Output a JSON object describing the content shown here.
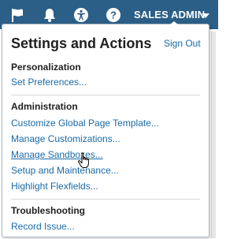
{
  "topbar": {
    "icons": [
      "flag-icon",
      "bell-icon",
      "accessibility-icon",
      "help-icon"
    ],
    "user_menu_label": "SALES ADMIN",
    "background": "#2c5f88"
  },
  "panel": {
    "title": "Settings and Actions",
    "sign_out": "Sign Out",
    "sections": [
      {
        "heading": "Personalization",
        "links": [
          "Set Preferences..."
        ]
      },
      {
        "heading": "Administration",
        "links": [
          "Customize Global Page Template...",
          "Manage Customizations...",
          "Manage Sandboxes...",
          "Setup and Maintenance...",
          "Highlight Flexfields..."
        ]
      },
      {
        "heading": "Troubleshooting",
        "links": [
          "Record Issue..."
        ]
      }
    ],
    "hovered_link": "Manage Sandboxes..."
  },
  "colors": {
    "link": "#1a6aa7",
    "heading": "#1f1f1f"
  }
}
